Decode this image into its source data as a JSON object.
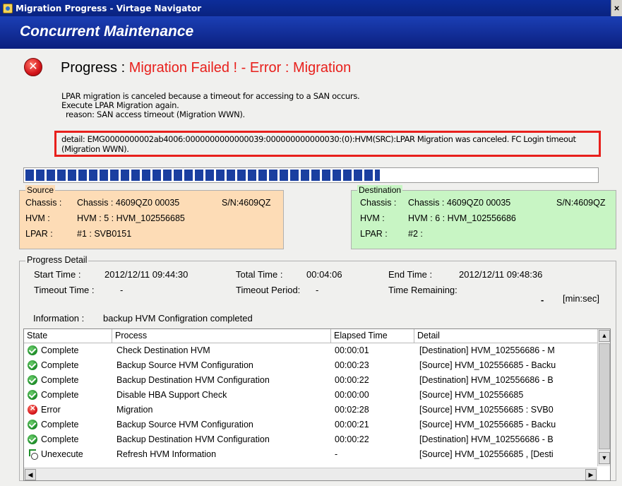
{
  "window": {
    "title": "Migration Progress - Virtage Navigator",
    "close_glyph": "×"
  },
  "header": {
    "title": "Concurrent Maintenance"
  },
  "status": {
    "icon": "error-icon",
    "label": "Progress :",
    "value": "Migration Failed ! - Error : Migration",
    "value_color": "#e8201c"
  },
  "messages": {
    "line1": "LPAR migration is canceled because a timeout for accessing to a SAN occurs.",
    "line2": "Execute LPAR Migration again.",
    "line3": "reason: SAN access timeout (Migration WWN).",
    "detail": "detail:  EMG0000000002ab4006:0000000000000039:000000000000030:(0):HVM(SRC):LPAR Migration was canceled. FC Login timeout (Migration WWN)."
  },
  "progress": {
    "fraction": 0.62,
    "bar_color": "#1a3fa0"
  },
  "source": {
    "title": "Source",
    "chassis_label": "Chassis :",
    "chassis_value": "Chassis : 4609QZ0 00035",
    "serial": "S/N:4609QZ",
    "hvm_label": "HVM :",
    "hvm_value": "HVM : 5 : HVM_102556685",
    "lpar_label": "LPAR :",
    "lpar_value": "#1 : SVB0151",
    "bg": "#fddcb6"
  },
  "destination": {
    "title": "Destination",
    "chassis_label": "Chassis :",
    "chassis_value": "Chassis : 4609QZ0 00035",
    "serial": "S/N:4609QZ",
    "hvm_label": "HVM :",
    "hvm_value": "HVM : 6 : HVM_102556686",
    "lpar_label": "LPAR :",
    "lpar_value": "#2 :",
    "bg": "#c8f5c4"
  },
  "progress_detail": {
    "title": "Progress Detail",
    "start_label": "Start Time :",
    "start_value": "2012/12/11 09:44:30",
    "total_label": "Total Time :",
    "total_value": "00:04:06",
    "end_label": "End Time :",
    "end_value": "2012/12/11 09:48:36",
    "timeout_label": "Timeout Time :",
    "timeout_value": "-",
    "period_label": "Timeout Period:",
    "period_value": "-",
    "remaining_label": "Time Remaining:",
    "remaining_value": "-",
    "remaining_unit": "[min:sec]",
    "info_label": "Information :",
    "info_value": "backup HVM Configration completed"
  },
  "table": {
    "columns": [
      "State",
      "Process",
      "Elapsed Time",
      "Detail"
    ],
    "rows": [
      {
        "state_icon": "complete-icon",
        "state": "Complete",
        "process": "Check Destination HVM",
        "elapsed": "00:00:01",
        "detail": "[Destination] HVM_102556686    - M"
      },
      {
        "state_icon": "complete-icon",
        "state": "Complete",
        "process": "Backup Source HVM Configuration",
        "elapsed": "00:00:23",
        "detail": "[Source] HVM_102556685    - Backu"
      },
      {
        "state_icon": "complete-icon",
        "state": "Complete",
        "process": "Backup Destination HVM Configuration",
        "elapsed": "00:00:22",
        "detail": "[Destination] HVM_102556686    - B"
      },
      {
        "state_icon": "complete-icon",
        "state": "Complete",
        "process": "Disable HBA Support Check",
        "elapsed": "00:00:00",
        "detail": "[Source] HVM_102556685"
      },
      {
        "state_icon": "error-icon",
        "state": "Error",
        "process": "Migration",
        "elapsed": "00:02:28",
        "detail": "[Source] HVM_102556685    : SVB0"
      },
      {
        "state_icon": "complete-icon",
        "state": "Complete",
        "process": "Backup Source HVM Configuration",
        "elapsed": "00:00:21",
        "detail": "[Source] HVM_102556685    - Backu"
      },
      {
        "state_icon": "complete-icon",
        "state": "Complete",
        "process": "Backup Destination HVM Configuration",
        "elapsed": "00:00:22",
        "detail": "[Destination] HVM_102556686    - B"
      },
      {
        "state_icon": "unexecute-icon",
        "state": "Unexecute",
        "process": "Refresh HVM Information",
        "elapsed": "-",
        "detail": "[Source] HVM_102556685  , [Desti"
      }
    ]
  }
}
